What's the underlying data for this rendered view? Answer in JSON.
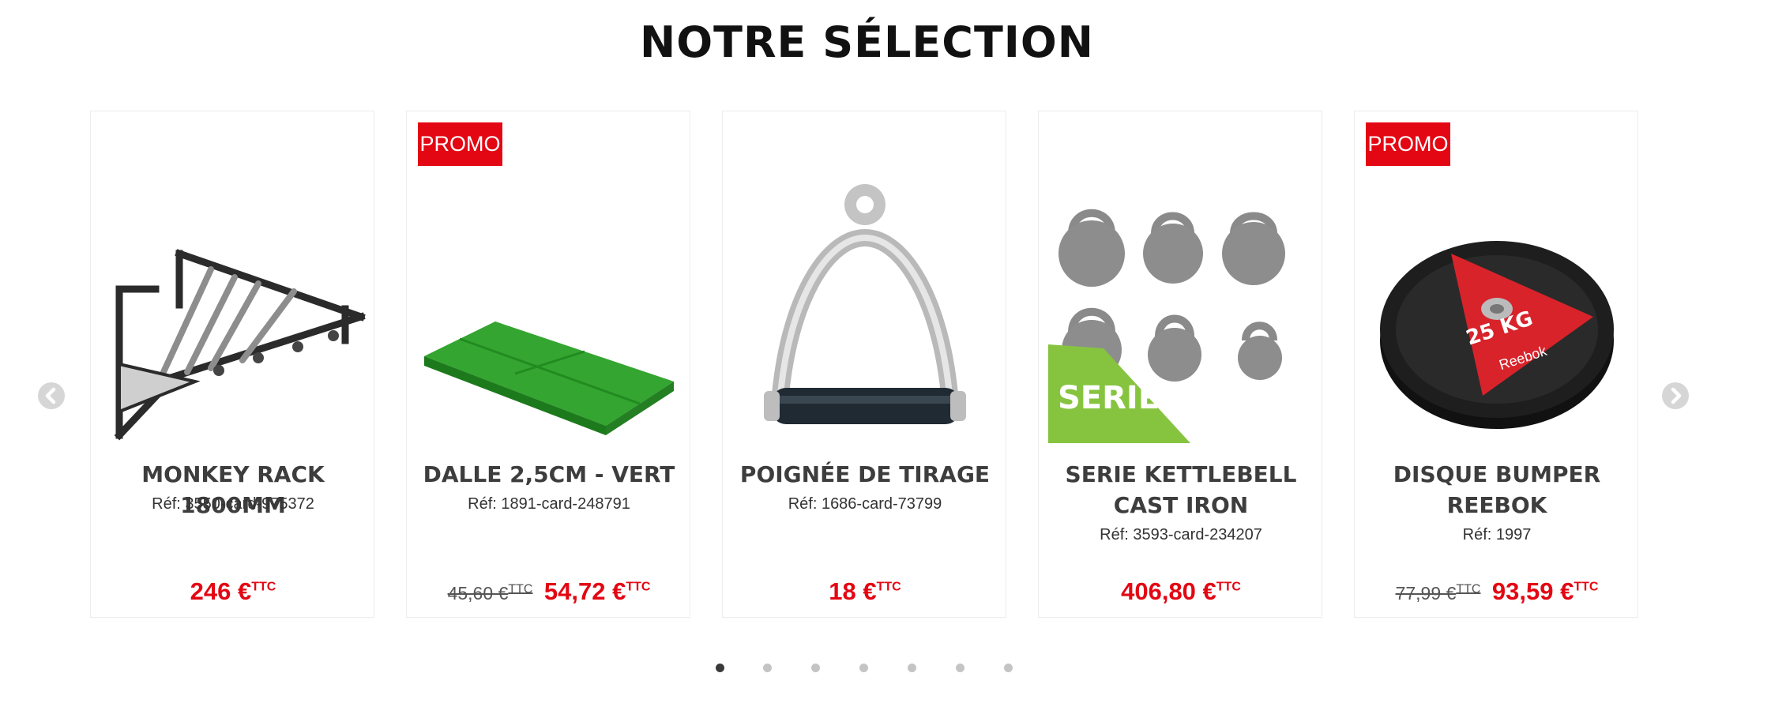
{
  "section": {
    "title": "NOTRE SÉLECTION"
  },
  "colors": {
    "accent": "#e30613",
    "text": "#3d3d3d",
    "border": "#ececec"
  },
  "carousel": {
    "prev_icon": "chevron-left-icon",
    "next_icon": "chevron-right-icon",
    "page_count": 7,
    "active_page": 1
  },
  "products": [
    {
      "name": "MONKEY RACK 1800MM",
      "ref": "Réf: 3550-card-975372",
      "price": "246 €",
      "ttc": "TTC",
      "promo": false,
      "image": "monkey-rack-image"
    },
    {
      "name": "DALLE 2,5CM - VERT",
      "ref": "Réf: 1891-card-248791",
      "old_price": "45,60 €",
      "price": "54,72 €",
      "ttc": "TTC",
      "promo": true,
      "badge": "PROMO",
      "image": "green-tile-image"
    },
    {
      "name": "POIGNÉE DE TIRAGE",
      "ref": "Réf: 1686-card-73799",
      "price": "18 €",
      "ttc": "TTC",
      "promo": false,
      "image": "pull-handle-image"
    },
    {
      "name_line1": "SERIE KETTLEBELL",
      "name_line2": "CAST IRON",
      "ref": "Réf: 3593-card-234207",
      "price": "406,80 €",
      "ttc": "TTC",
      "promo": false,
      "overlay_label": "SERIE",
      "image": "kettlebell-set-image"
    },
    {
      "name_line1": "DISQUE BUMPER",
      "name_line2": "REEBOK",
      "ref": "Réf: 1997",
      "old_price": "77,99 €",
      "price": "93,59 €",
      "ttc": "TTC",
      "promo": true,
      "badge": "PROMO",
      "plate_weight": "25 KG",
      "plate_brand": "Reebok",
      "image": "bumper-plate-image"
    }
  ]
}
